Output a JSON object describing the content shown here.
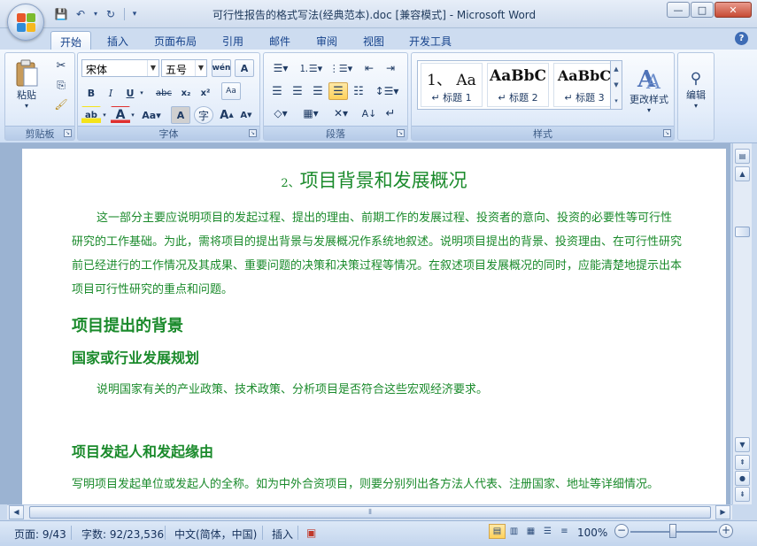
{
  "window": {
    "title": "可行性报告的格式写法(经典范本).doc [兼容模式] - Microsoft Word",
    "controls": {
      "minimize": "—",
      "maximize": "□",
      "close": "✕"
    }
  },
  "qat": {
    "save": "💾",
    "undo": "↶",
    "redo": "↻",
    "customize": "▾"
  },
  "tabs": [
    "开始",
    "插入",
    "页面布局",
    "引用",
    "邮件",
    "审阅",
    "视图",
    "开发工具"
  ],
  "help_label": "?",
  "ribbon": {
    "clipboard": {
      "label": "剪贴板",
      "paste_label": "粘贴"
    },
    "font": {
      "label": "字体",
      "font_name": "宋体",
      "font_size": "五号"
    },
    "paragraph": {
      "label": "段落"
    },
    "styles": {
      "label": "样式",
      "tiles": [
        {
          "sample": "1、 Aa",
          "name": "↵ 标题 1"
        },
        {
          "sample": "AaBbC",
          "name": "↵ 标题 2"
        },
        {
          "sample": "AaBbC",
          "name": "↵ 标题 3"
        }
      ],
      "change_styles": "更改样式"
    },
    "editing": {
      "label": "编辑"
    }
  },
  "document": {
    "title_number": "2、",
    "title_text": "项目背景和发展概况",
    "intro_paragraph": "这一部分主要应说明项目的发起过程、提出的理由、前期工作的发展过程、投资者的意向、投资的必要性等可行性研究的工作基础。为此，需将项目的提出背景与发展概况作系统地叙述。说明项目提出的背景、投资理由、在可行性研究前已经进行的工作情况及其成果、重要问题的决策和决策过程等情况。在叙述项目发展概况的同时，应能清楚地提示出本项目可行性研究的重点和问题。",
    "heading_background": "项目提出的背景",
    "heading_planning": "国家或行业发展规划",
    "planning_paragraph": "说明国家有关的产业政策、技术政策、分析项目是否符合这些宏观经济要求。",
    "heading_initiator": "项目发起人和发起缘由",
    "initiator_paragraph": "写明项目发起单位或发起人的全称。如为中外合资项目，则要分别列出各方法人代表、注册国家、地址等详细情况。"
  },
  "statusbar": {
    "page": "页面: 9/43",
    "words": "字数: 92/23,536",
    "language": "中文(简体，中国)",
    "mode": "插入",
    "zoom": "100%"
  }
}
